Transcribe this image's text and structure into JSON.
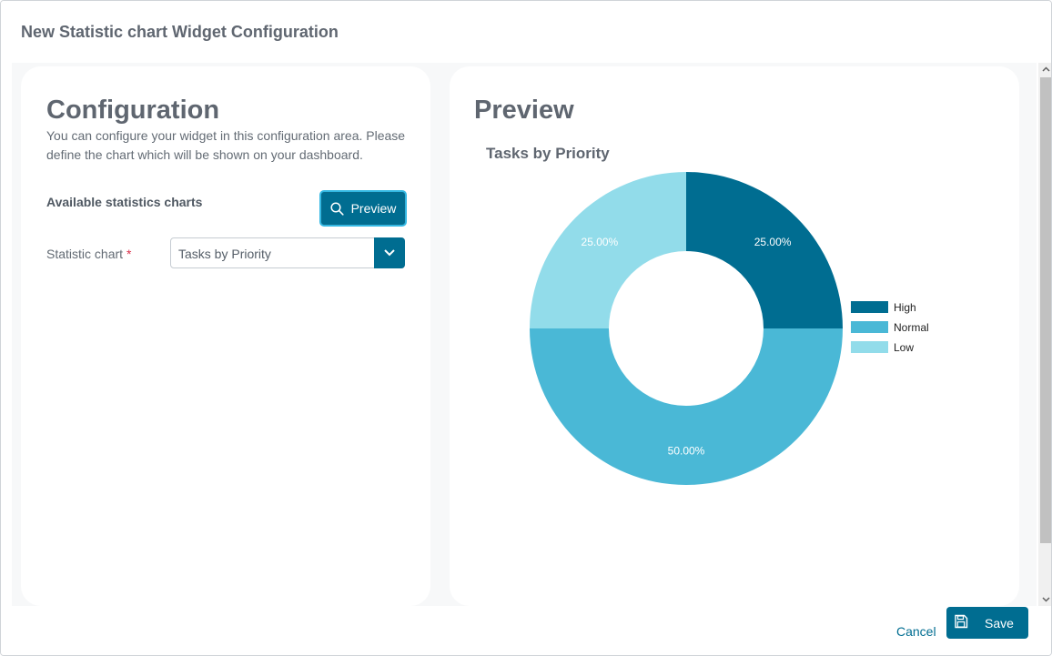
{
  "dialog": {
    "title": "New Statistic chart Widget Configuration"
  },
  "config": {
    "heading": "Configuration",
    "description": "You can configure your widget in this configuration area. Please define the chart which will be shown on your dashboard.",
    "section_label": "Available statistics charts",
    "preview_button": "Preview",
    "field_label": "Statistic chart",
    "required_mark": "*",
    "selected_chart": "Tasks by Priority"
  },
  "preview": {
    "heading": "Preview"
  },
  "chart_data": {
    "type": "pie",
    "title": "Tasks by Priority",
    "donut": true,
    "categories": [
      "High",
      "Normal",
      "Low"
    ],
    "values": [
      25,
      50,
      25
    ],
    "labels": [
      "25.00%",
      "50.00%",
      "25.00%"
    ],
    "colors": [
      "#006d91",
      "#4ab8d6",
      "#92dcea"
    ],
    "legend": "right"
  },
  "footer": {
    "cancel_label": "Cancel",
    "save_label": "Save"
  },
  "icons": {
    "preview": "search-icon",
    "select": "chevron-down-icon",
    "save": "save-icon"
  }
}
